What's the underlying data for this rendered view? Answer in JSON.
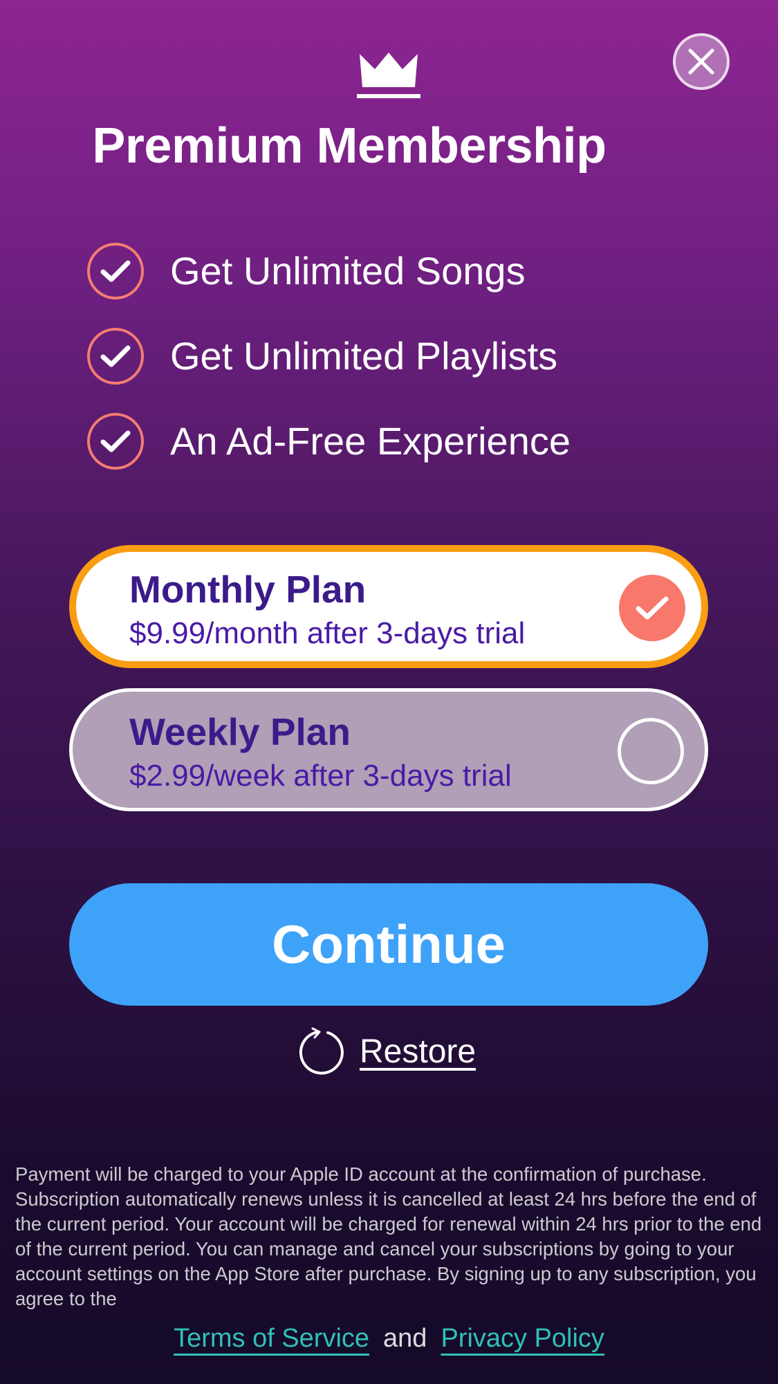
{
  "header": {
    "close_icon": "close-icon",
    "crown_icon": "crown-icon",
    "title": "Premium Membership"
  },
  "features": [
    {
      "icon": "check-circle-icon",
      "label": "Get Unlimited Songs"
    },
    {
      "icon": "check-circle-icon",
      "label": "Get Unlimited Playlists"
    },
    {
      "icon": "check-circle-icon",
      "label": "An Ad-Free Experience"
    }
  ],
  "plans": [
    {
      "name": "Monthly Plan",
      "price": "$9.99/month after 3-days trial",
      "selected": true
    },
    {
      "name": "Weekly Plan",
      "price": "$2.99/week after 3-days trial",
      "selected": false
    }
  ],
  "actions": {
    "continue_label": "Continue",
    "restore_label": "Restore",
    "restore_icon": "refresh-icon"
  },
  "legal": {
    "text": "Payment will be charged to your Apple ID account at the confirmation of purchase. Subscription automatically renews unless it is cancelled at least 24 hrs before the end of the current period. Your account will be charged for renewal within 24 hrs prior to the end of the current period. You can manage and cancel your subscriptions by going to your account settings on the App Store after purchase. By signing up to any subscription, you agree to the",
    "terms_label": "Terms of Service",
    "and_label": "and",
    "privacy_label": "Privacy Policy"
  },
  "colors": {
    "accent_blue": "#3ea2f9",
    "selected_border": "#f99d12",
    "check_coral": "#f8786c",
    "plan_text": "#3b1b8a",
    "link_teal": "#2fc1b7"
  }
}
